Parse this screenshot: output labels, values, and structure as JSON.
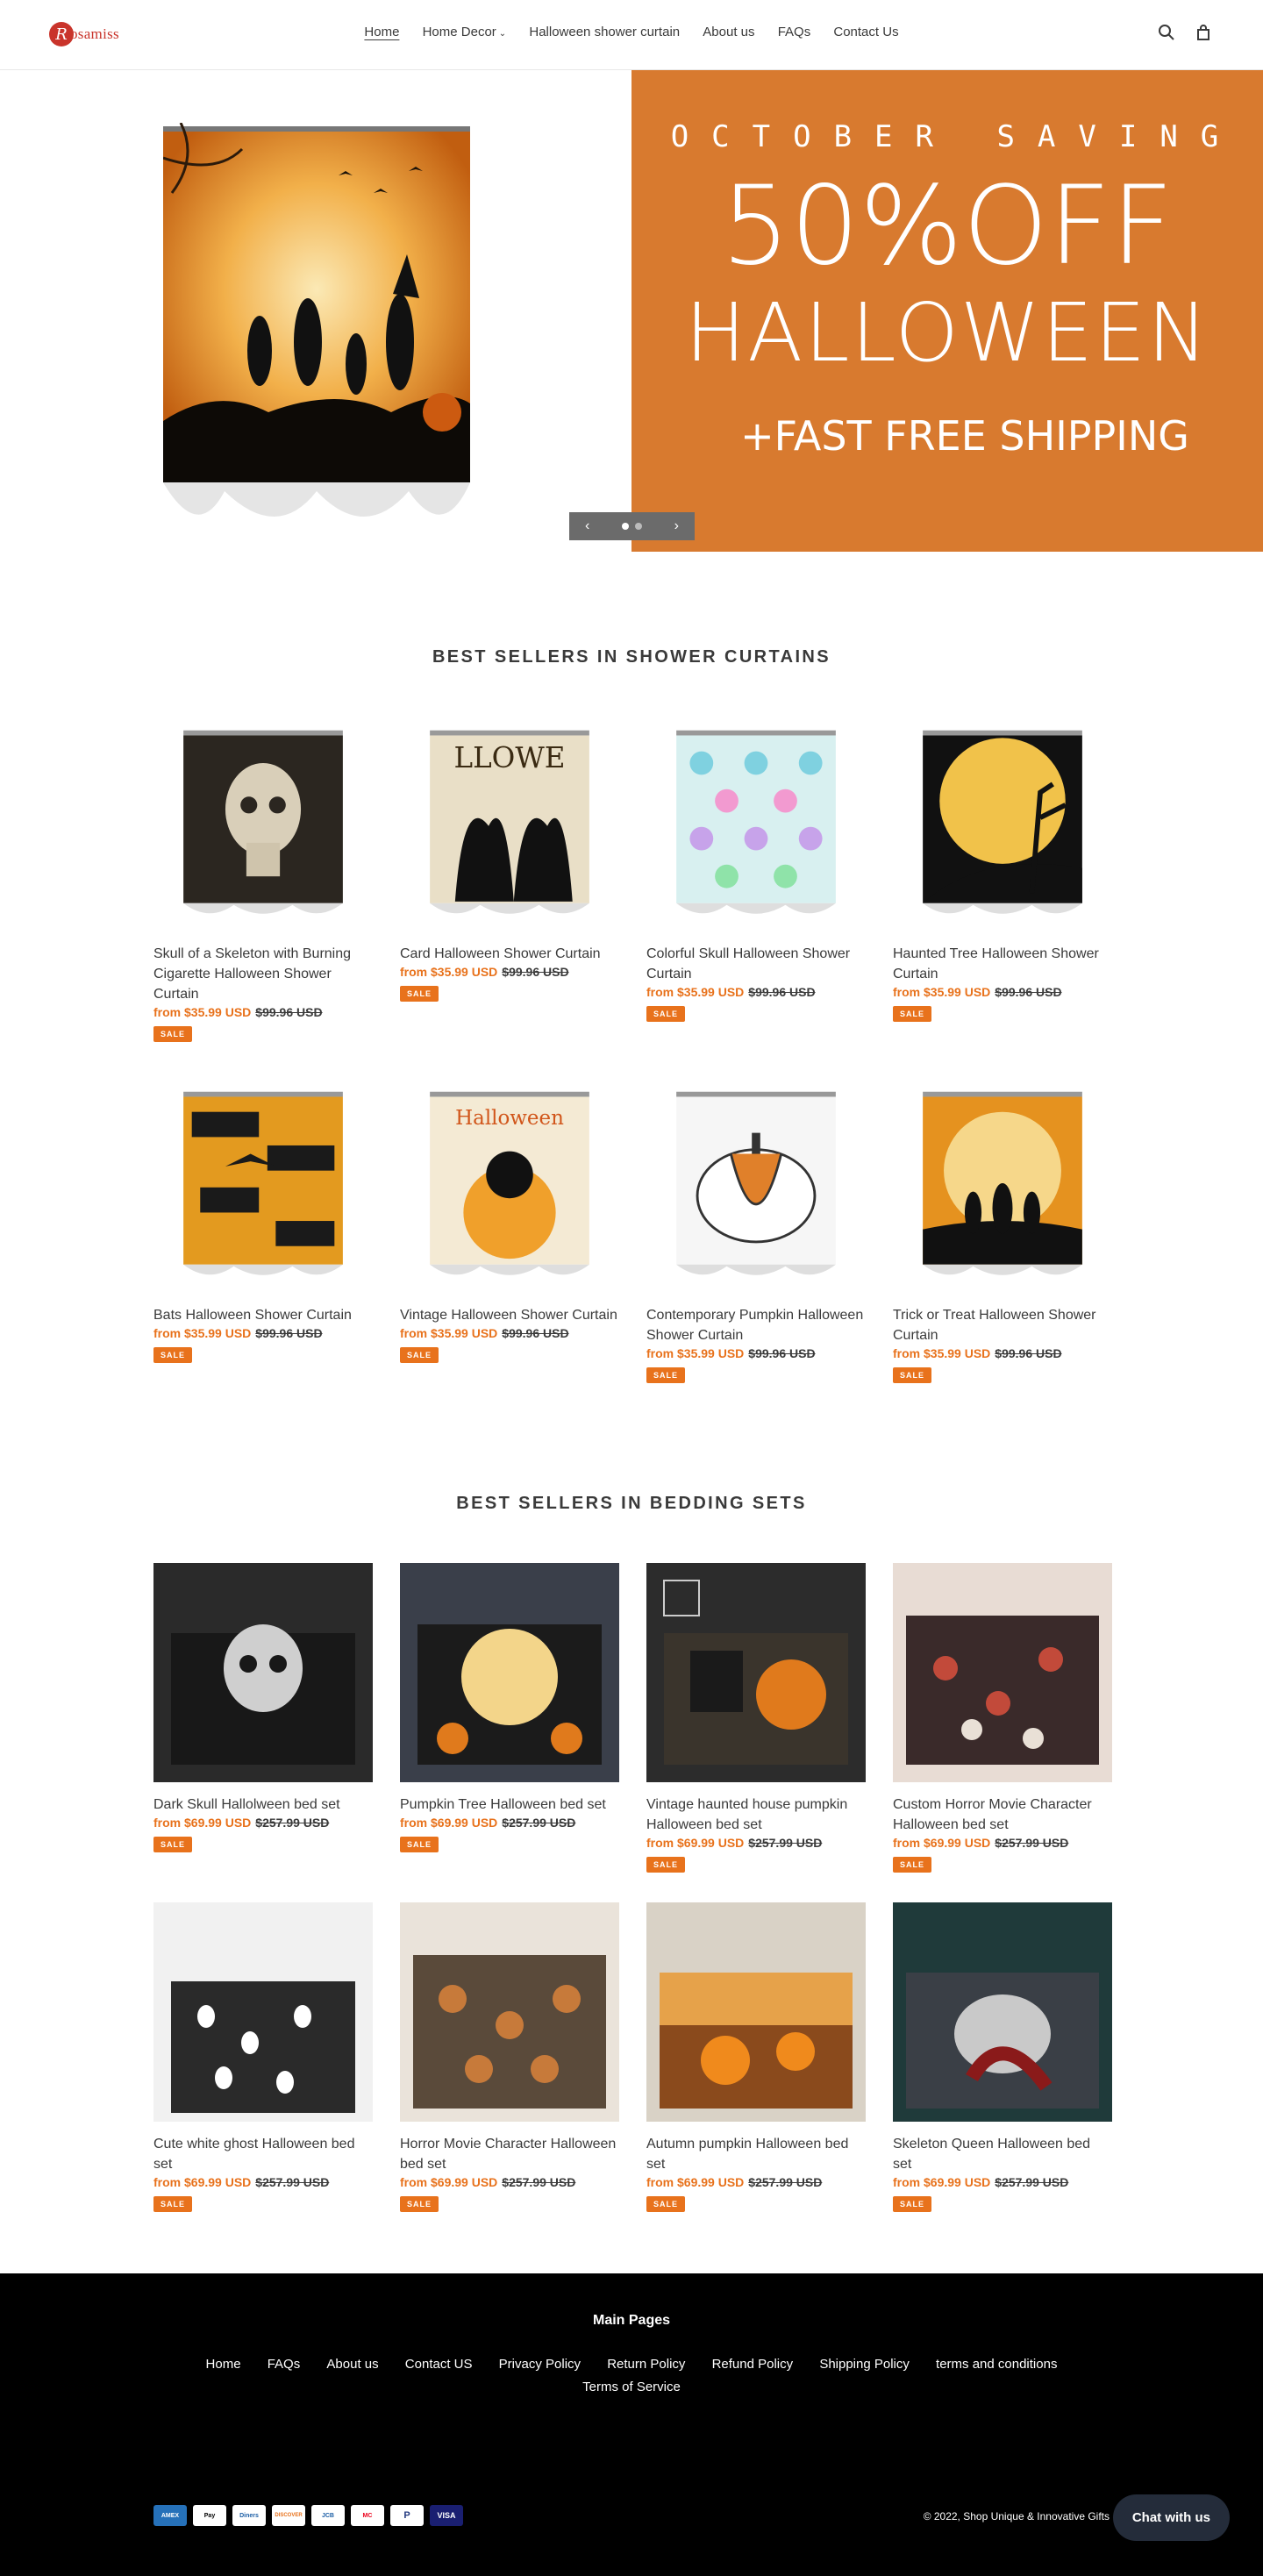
{
  "header": {
    "brand": "Rosamiss",
    "brand_initial": "R",
    "nav": [
      "Home",
      "Home Decor",
      "Halloween shower curtain",
      "About us",
      "FAQs",
      "Contact Us"
    ],
    "icons": [
      "search-icon",
      "cart-icon"
    ]
  },
  "hero": {
    "line1": "OCTOBER SAVING",
    "line2": "50%OFF",
    "line3": "HALLOWEEN",
    "line4": "+FAST FREE SHIPPING",
    "bg_color": "#d87a2f",
    "slide_count": 2,
    "active_slide": 1
  },
  "curtains": {
    "title": "BEST SELLERS IN SHOWER CURTAINS",
    "items": [
      {
        "name": "Skull of a Skeleton with Burning Cigarette Halloween Shower Curtain",
        "price": "from $35.99 USD",
        "old": "$99.96 USD",
        "badge": "SALE"
      },
      {
        "name": "Card Halloween Shower Curtain",
        "price": "from $35.99 USD",
        "old": "$99.96 USD",
        "badge": "SALE"
      },
      {
        "name": "Colorful Skull Halloween Shower Curtain",
        "price": "from $35.99 USD",
        "old": "$99.96 USD",
        "badge": "SALE"
      },
      {
        "name": "Haunted Tree Halloween Shower Curtain",
        "price": "from $35.99 USD",
        "old": "$99.96 USD",
        "badge": "SALE"
      },
      {
        "name": "Bats Halloween Shower Curtain",
        "price": "from $35.99 USD",
        "old": "$99.96 USD",
        "badge": "SALE"
      },
      {
        "name": "Vintage Halloween Shower Curtain",
        "price": "from $35.99 USD",
        "old": "$99.96 USD",
        "badge": "SALE"
      },
      {
        "name": "Contemporary Pumpkin Halloween Shower Curtain",
        "price": "from $35.99 USD",
        "old": "$99.96 USD",
        "badge": "SALE"
      },
      {
        "name": "Trick or Treat Halloween Shower Curtain",
        "price": "from $35.99 USD",
        "old": "$99.96 USD",
        "badge": "SALE"
      }
    ]
  },
  "bedding": {
    "title": "BEST SELLERS IN BEDDING SETS",
    "items": [
      {
        "name": "Dark Skull Hallolween bed set",
        "price": "from $69.99 USD",
        "old": "$257.99 USD",
        "badge": "SALE"
      },
      {
        "name": "Pumpkin Tree Halloween bed set",
        "price": "from $69.99 USD",
        "old": "$257.99 USD",
        "badge": "SALE"
      },
      {
        "name": "Vintage haunted house pumpkin Halloween bed set",
        "price": "from $69.99 USD",
        "old": "$257.99 USD",
        "badge": "SALE"
      },
      {
        "name": "Custom Horror Movie Character Halloween bed set",
        "price": "from $69.99 USD",
        "old": "$257.99 USD",
        "badge": "SALE"
      },
      {
        "name": "Cute white ghost Halloween bed set",
        "price": "from $69.99 USD",
        "old": "$257.99 USD",
        "badge": "SALE"
      },
      {
        "name": "Horror Movie Character Halloween bed set",
        "price": "from $69.99 USD",
        "old": "$257.99 USD",
        "badge": "SALE"
      },
      {
        "name": "Autumn pumpkin Halloween bed set",
        "price": "from $69.99 USD",
        "old": "$257.99 USD",
        "badge": "SALE"
      },
      {
        "name": "Skeleton Queen Halloween bed set",
        "price": "from $69.99 USD",
        "old": "$257.99 USD",
        "badge": "SALE"
      }
    ]
  },
  "footer": {
    "title": "Main Pages",
    "links": [
      "Home",
      "FAQs",
      "About us",
      "Contact US",
      "Privacy Policy",
      "Return Policy",
      "Refund Policy",
      "Shipping Policy",
      "terms and conditions",
      "Terms of Service"
    ],
    "payments": [
      "AMEX",
      "Pay",
      "Diners",
      "DISCOVER",
      "JCB",
      "MC",
      "P",
      "VISA"
    ],
    "copyright": "© 2022, Shop Unique & Innovative Gifts",
    "chat": "Chat with us"
  }
}
